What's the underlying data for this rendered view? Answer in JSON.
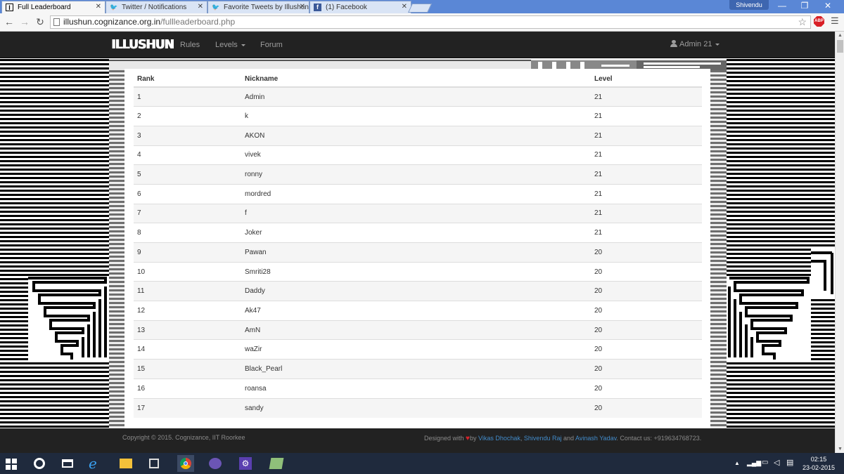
{
  "browser": {
    "tabs": [
      {
        "label": "Full Leaderboard",
        "icon": "illushun-favicon-icon",
        "active": true
      },
      {
        "label": "Twitter / Notifications",
        "icon": "twitter-bird-icon",
        "active": false
      },
      {
        "label": "Favorite Tweets by Illushun",
        "icon": "twitter-bird-icon",
        "active": false
      },
      {
        "label": "(1) Facebook",
        "icon": "facebook-icon",
        "active": false
      }
    ],
    "profile_name": "Shivendu",
    "url_host": "illushun.cognizance.org.in",
    "url_path": "/fullleaderboard.php",
    "extension_label": "ABP"
  },
  "navbar": {
    "brand": "ILLUSHUN",
    "links": [
      "Rules",
      "Levels",
      "Forum"
    ],
    "user": "Admin 21"
  },
  "leaderboard": {
    "headers": [
      "Rank",
      "Nickname",
      "Level"
    ],
    "rows": [
      {
        "rank": "1",
        "nickname": "Admin",
        "level": "21"
      },
      {
        "rank": "2",
        "nickname": "k",
        "level": "21"
      },
      {
        "rank": "3",
        "nickname": "AKON",
        "level": "21"
      },
      {
        "rank": "4",
        "nickname": "vivek",
        "level": "21"
      },
      {
        "rank": "5",
        "nickname": "ronny",
        "level": "21"
      },
      {
        "rank": "6",
        "nickname": "mordred",
        "level": "21"
      },
      {
        "rank": "7",
        "nickname": "f",
        "level": "21"
      },
      {
        "rank": "8",
        "nickname": "Joker",
        "level": "21"
      },
      {
        "rank": "9",
        "nickname": "Pawan",
        "level": "20"
      },
      {
        "rank": "10",
        "nickname": "Smriti28",
        "level": "20"
      },
      {
        "rank": "11",
        "nickname": "Daddy",
        "level": "20"
      },
      {
        "rank": "12",
        "nickname": "Ak47",
        "level": "20"
      },
      {
        "rank": "13",
        "nickname": "AmN",
        "level": "20"
      },
      {
        "rank": "14",
        "nickname": "waZir",
        "level": "20"
      },
      {
        "rank": "15",
        "nickname": "Black_Pearl",
        "level": "20"
      },
      {
        "rank": "16",
        "nickname": "roansa",
        "level": "20"
      },
      {
        "rank": "17",
        "nickname": "sandy",
        "level": "20"
      }
    ]
  },
  "footer": {
    "copyright": "Copyright © 2015. Cognizance, IIT Roorkee",
    "designed_with": "Designed with",
    "by": "by",
    "author1": "Vikas Dhochak",
    "sep1": ",",
    "author2": "Shivendu Raj",
    "and": "and",
    "author3": "Avinash Yadav",
    "contact": ". Contact us: +919634768723."
  },
  "taskbar": {
    "time": "02:15",
    "date": "23-02-2015"
  },
  "colors": {
    "navbar_bg": "#222222",
    "link_blue": "#428bca",
    "heart_red": "#d9232a",
    "tab_strip": "#5a87d6",
    "taskbar_bg": "#1f2a3d"
  }
}
